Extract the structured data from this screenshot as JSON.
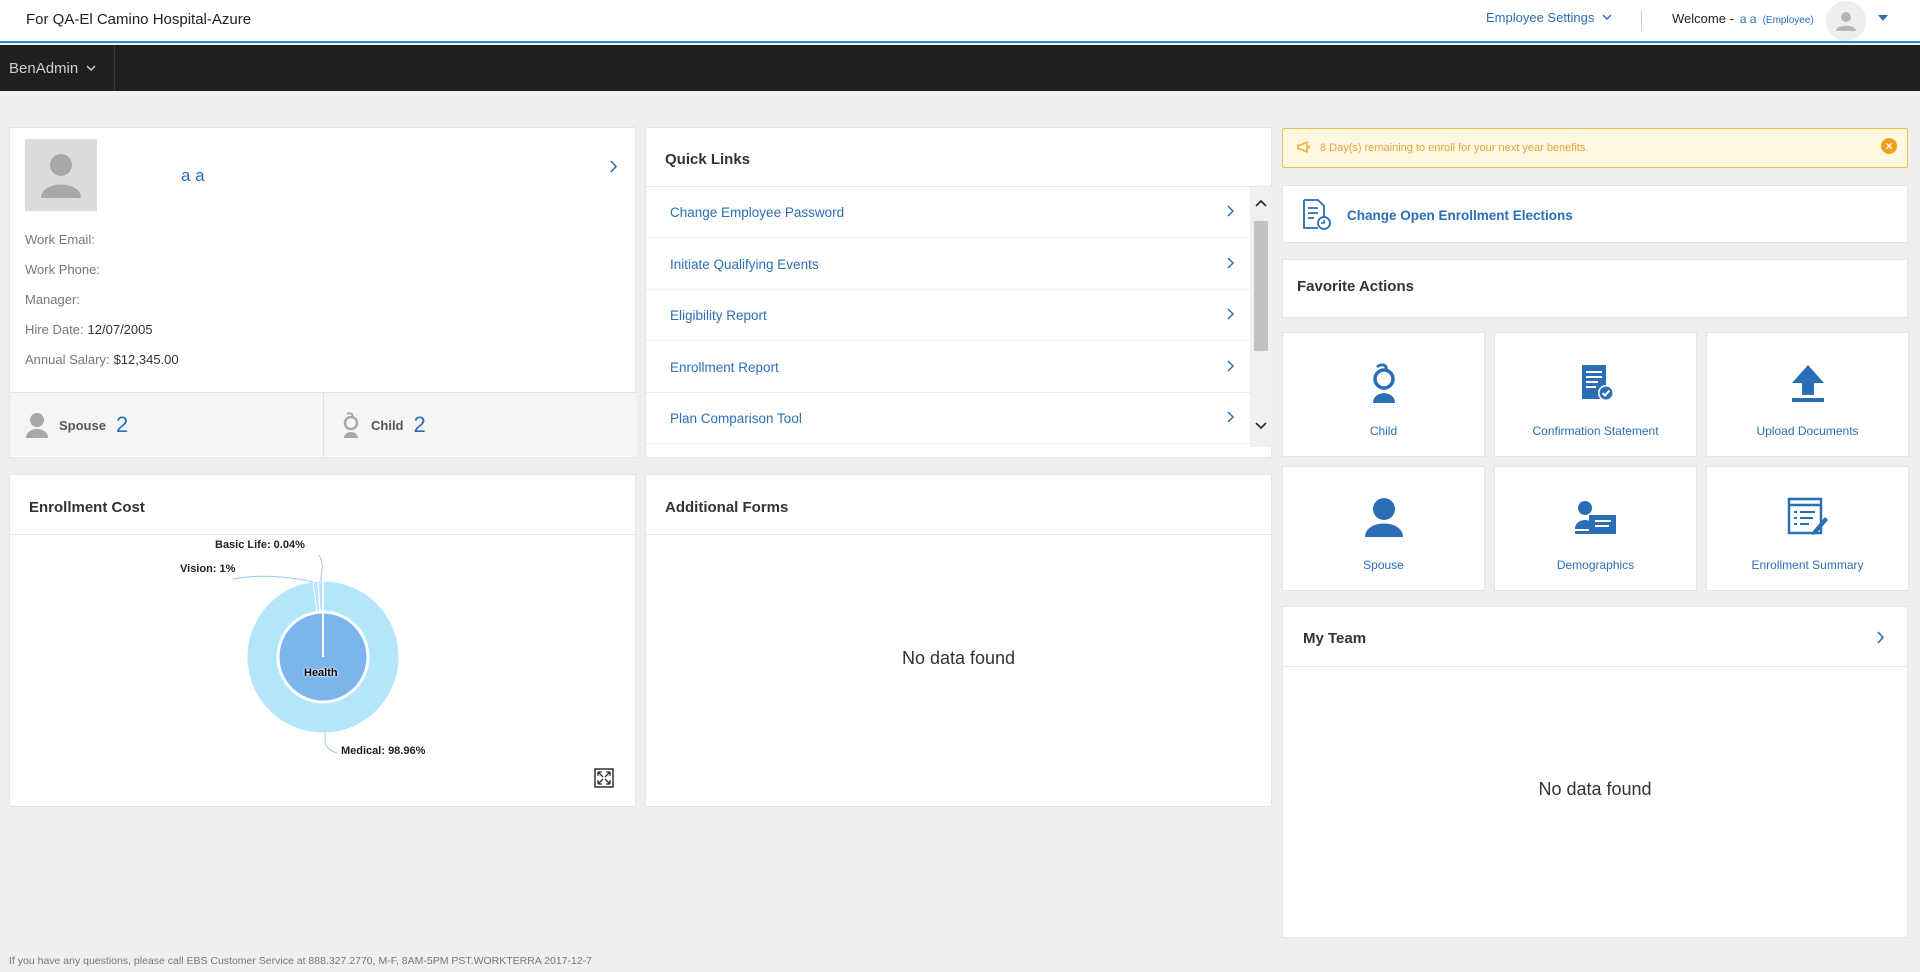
{
  "header": {
    "company": "For QA-El Camino Hospital-Azure",
    "employee_settings": "Employee Settings",
    "welcome": "Welcome -",
    "user_name": "a a",
    "user_role": "(Employee)"
  },
  "nav": {
    "menu_label": "BenAdmin"
  },
  "profile": {
    "name": "a a",
    "fields": [
      {
        "label": "Work Email:",
        "value": ""
      },
      {
        "label": "Work Phone:",
        "value": ""
      },
      {
        "label": "Manager:",
        "value": ""
      },
      {
        "label": "Hire Date:",
        "value": "12/07/2005"
      },
      {
        "label": "Annual Salary:",
        "value": "$12,345.00"
      }
    ],
    "dependents": [
      {
        "label": "Spouse",
        "count": "2"
      },
      {
        "label": "Child",
        "count": "2"
      }
    ]
  },
  "quick_links": {
    "title": "Quick Links",
    "items": [
      "Change Employee Password",
      "Initiate Qualifying Events",
      "Eligibility Report",
      "Enrollment Report",
      "Plan Comparison Tool"
    ]
  },
  "enrollment_cost": {
    "title": "Enrollment Cost",
    "labels": {
      "basic_life": "Basic Life: 0.04%",
      "vision": "Vision: 1%",
      "medical": "Medical: 98.96%",
      "inner": "Health"
    }
  },
  "chart_data": {
    "type": "pie",
    "title": "Enrollment Cost",
    "inner_ring": {
      "categories": [
        "Health"
      ],
      "values": [
        100
      ]
    },
    "outer_ring": {
      "categories": [
        "Medical",
        "Vision",
        "Basic Life"
      ],
      "values": [
        98.96,
        1,
        0.04
      ]
    },
    "colors": {
      "inner": "#7cb5ec",
      "outer": "#b3e5fb"
    }
  },
  "additional_forms": {
    "title": "Additional Forms",
    "empty": "No data found"
  },
  "alert": {
    "text": "8 Day(s) remaining to enroll for your next year benefits."
  },
  "open_enrollment": {
    "label": "Change Open Enrollment Elections"
  },
  "favorite_actions": {
    "title": "Favorite Actions",
    "tiles": [
      {
        "label": "Child",
        "icon": "child-icon"
      },
      {
        "label": "Confirmation Statement",
        "icon": "confirmation-statement-icon"
      },
      {
        "label": "Upload Documents",
        "icon": "upload-icon"
      },
      {
        "label": "Spouse",
        "icon": "spouse-icon"
      },
      {
        "label": "Demographics",
        "icon": "demographics-icon"
      },
      {
        "label": "Enrollment Summary",
        "icon": "enrollment-summary-icon"
      }
    ]
  },
  "my_team": {
    "title": "My Team",
    "empty": "No data found"
  },
  "footer": {
    "text": "If you have any questions, please call EBS Customer Service at 888.327.2770, M-F, 8AM-5PM PST.WORKTERRA 2017-12-7"
  },
  "colors": {
    "accent": "#2a6fb5",
    "nav_bg": "#1f1f1f",
    "alert_bg": "#fff8e1",
    "alert_text": "#e8a33a"
  }
}
